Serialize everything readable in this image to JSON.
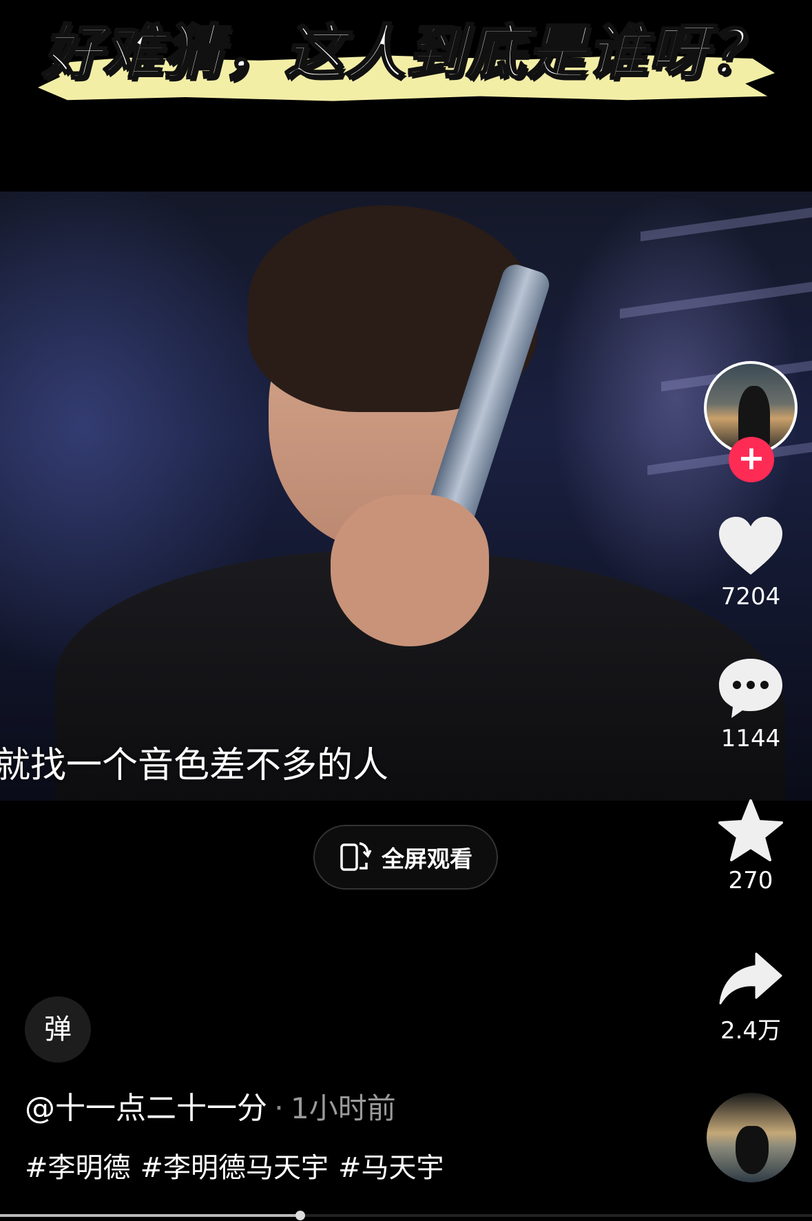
{
  "banner": {
    "title": "好难猜，这人到底是谁呀？"
  },
  "video": {
    "subtitle": "就找一个音色差不多的人"
  },
  "fullscreen": {
    "label": "全屏观看",
    "icon": "rotate-screen-icon"
  },
  "rail": {
    "follow": "+",
    "like_count": "7204",
    "comment_count": "1144",
    "favorite_count": "270",
    "share_count": "2.4万"
  },
  "danmu": {
    "label": "弹"
  },
  "post": {
    "author": "@十一点二十一分",
    "separator": "·",
    "time": "1小时前",
    "tags": [
      "#李明德",
      "#李明德马天宇",
      "#马天宇"
    ]
  },
  "colors": {
    "follow": "#fe2c55",
    "banner_highlight": "#f3eea6"
  },
  "progress": {
    "fraction": 0.37
  }
}
